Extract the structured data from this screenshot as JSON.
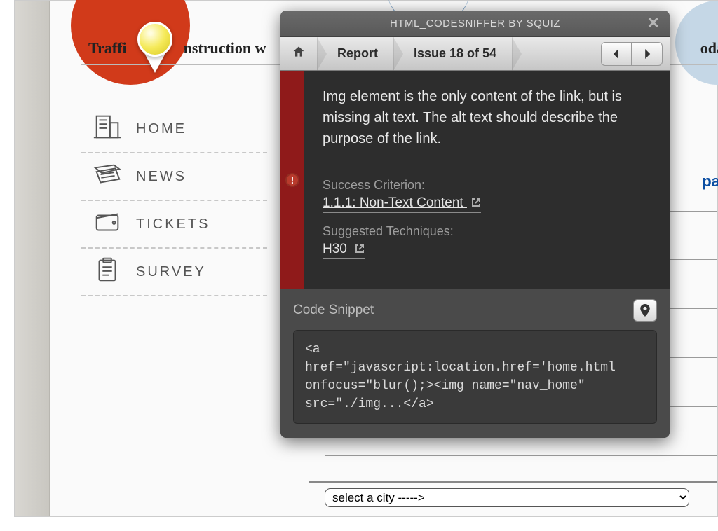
{
  "page": {
    "headline_left": "Traffi",
    "headline_mid": "nstruction w",
    "headline_right": "oda",
    "link_fragment": "pai"
  },
  "sidebar": {
    "items": [
      {
        "label": "HOME",
        "icon": "building"
      },
      {
        "label": "NEWS",
        "icon": "newspaper"
      },
      {
        "label": "TICKETS",
        "icon": "wallet"
      },
      {
        "label": "SURVEY",
        "icon": "clipboard"
      }
    ]
  },
  "panel": {
    "title": "HTML_CODESNIFFER BY SQUIZ",
    "breadcrumbs": {
      "report": "Report",
      "issue": "Issue 18 of 54"
    },
    "message": "Img element is the only content of the link, but is missing alt text. The alt text should describe the purpose of the link.",
    "criterion_label": "Success Criterion:",
    "criterion_value": "1.1.1: Non-Text Content",
    "technique_label": "Suggested Techniques:",
    "technique_value": "H30",
    "snippet_label": "Code Snippet",
    "code": "<a\nhref=\"javascript:location.href='home.html\nonfocus=\"blur();><img name=\"nav_home\"\nsrc=\"./img...</a>"
  },
  "select": {
    "value": "select a city ----->"
  }
}
